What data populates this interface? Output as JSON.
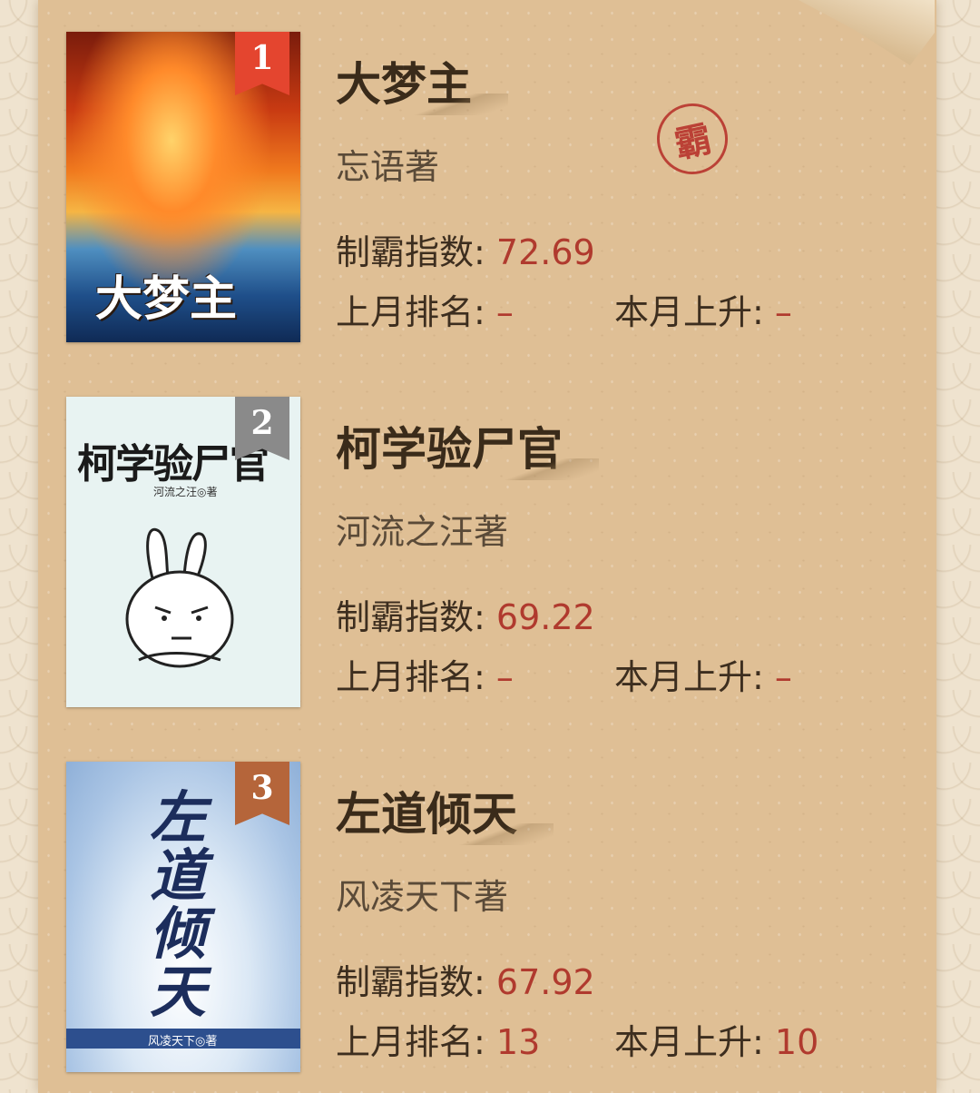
{
  "seal_char": "霸",
  "labels": {
    "index": "制霸指数: ",
    "last_rank": "上月排名: ",
    "rise": "本月上升: "
  },
  "books": [
    {
      "rank": "1",
      "title": "大梦主",
      "author": "忘语著",
      "index_value": "72.69",
      "last_rank_value": "–",
      "rise_value": "–",
      "cover_title": "大梦主",
      "badge_color": "#e4452f"
    },
    {
      "rank": "2",
      "title": "柯学验尸官",
      "author": "河流之汪著",
      "index_value": "69.22",
      "last_rank_value": "–",
      "rise_value": "–",
      "cover_title": "柯学验尸官",
      "cover_author": "河流之汪◎著",
      "badge_color": "#8a8a8a"
    },
    {
      "rank": "3",
      "title": "左道倾天",
      "author": "风凌天下著",
      "index_value": "67.92",
      "last_rank_value": "13",
      "rise_value": "10",
      "cover_title": "左道倾天",
      "cover_author": "风凌天下◎著",
      "badge_color": "#b5653a"
    }
  ]
}
